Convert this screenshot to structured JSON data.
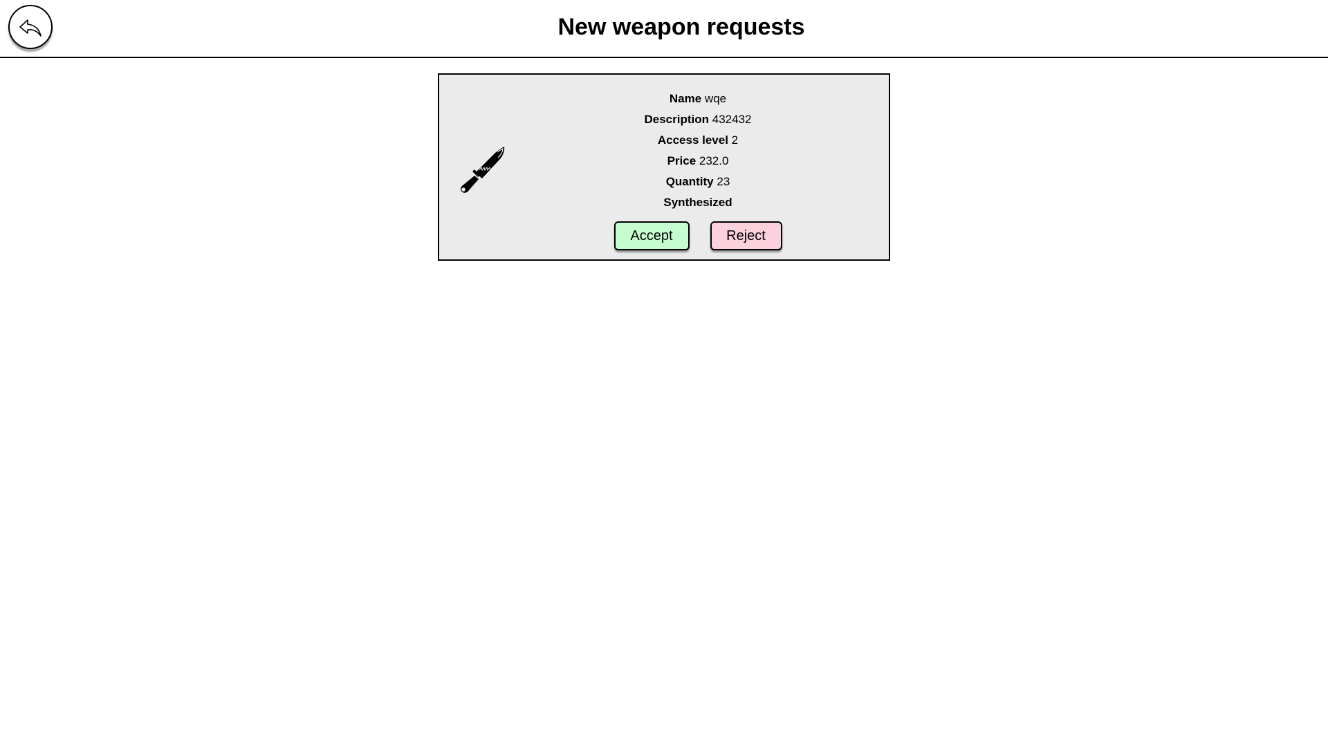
{
  "header": {
    "title": "New weapon requests",
    "back_icon": "back-arrow-icon"
  },
  "request": {
    "icon": "knife-icon",
    "fields": {
      "name_label": "Name",
      "name_value": "wqe",
      "description_label": "Description",
      "description_value": "432432",
      "access_label": "Access level",
      "access_value": "2",
      "price_label": "Price",
      "price_value": "232.0",
      "quantity_label": "Quantity",
      "quantity_value": "23",
      "synthesized_label": "Synthesized"
    },
    "accept_label": "Accept",
    "reject_label": "Reject",
    "colors": {
      "card_bg": "#ebebeb",
      "accept_bg": "#c6fdd0",
      "reject_bg": "#fad1dd"
    }
  }
}
